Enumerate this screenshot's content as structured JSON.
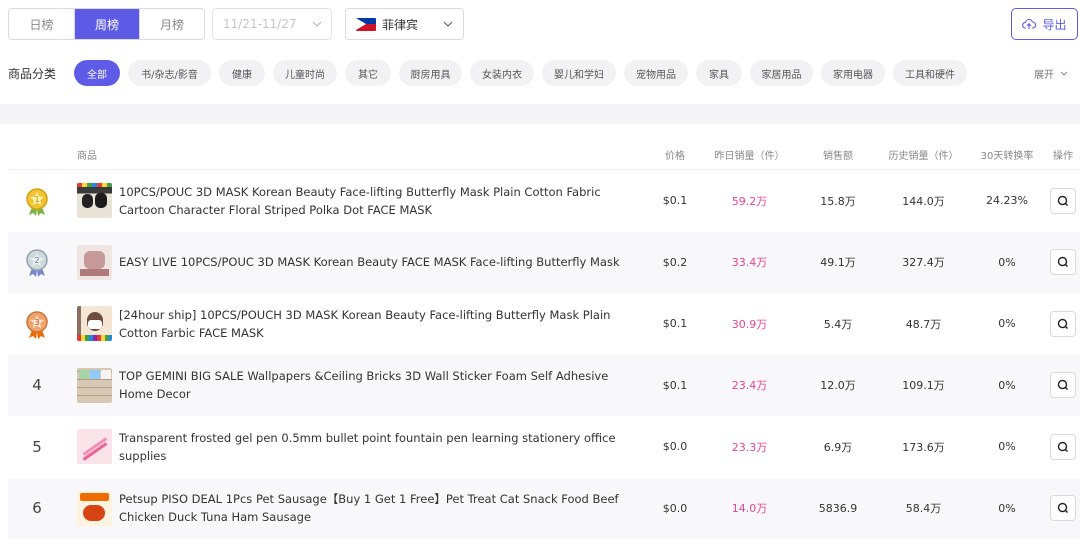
{
  "period_tabs": [
    "日榜",
    "周榜",
    "月榜"
  ],
  "active_period": 1,
  "date_range": {
    "value": "11/21-11/27"
  },
  "country": {
    "label": "菲律宾"
  },
  "export_label": "导出",
  "categories": {
    "label": "商品分类",
    "items": [
      "全部",
      "书/杂志/影音",
      "健康",
      "儿童时尚",
      "其它",
      "厨房用具",
      "女装内衣",
      "婴儿和学妇",
      "宠物用品",
      "家具",
      "家居用品",
      "家用电器",
      "工具和硬件"
    ],
    "active_index": 0,
    "expand_label": "展开"
  },
  "table": {
    "headers": {
      "product": "商品",
      "price": "价格",
      "yesterday_sales": "昨日销量（件）",
      "revenue": "销售额",
      "history_sales": "历史销量（件）",
      "conversion": "30天转换率",
      "action": "操作"
    },
    "rows": [
      {
        "rank": "1",
        "medal": "gold",
        "name": "10PCS/POUC 3D MASK Korean Beauty Face-lifting Butterfly Mask Plain Cotton Fabric Cartoon Character Floral Striped Polka Dot FACE MASK",
        "price": "$0.1",
        "yesterday_sales": "59.2万",
        "revenue": "15.8万",
        "history_sales": "144.0万",
        "conversion": "24.23%"
      },
      {
        "rank": "2",
        "medal": "silver",
        "name": "EASY LIVE 10PCS/POUC 3D MASK Korean Beauty FACE MASK Face-lifting Butterfly Mask",
        "price": "$0.2",
        "yesterday_sales": "33.4万",
        "revenue": "49.1万",
        "history_sales": "327.4万",
        "conversion": "0%"
      },
      {
        "rank": "3",
        "medal": "bronze",
        "name": "[24hour ship] 10PCS/POUCH 3D MASK Korean Beauty Face-lifting Butterfly Mask Plain Cotton Farbic FACE MASK",
        "price": "$0.1",
        "yesterday_sales": "30.9万",
        "revenue": "5.4万",
        "history_sales": "48.7万",
        "conversion": "0%"
      },
      {
        "rank": "4",
        "name": "TOP GEMINI BIG SALE Wallpapers &Ceiling Bricks 3D Wall Sticker Foam Self Adhesive Home Decor",
        "price": "$0.1",
        "yesterday_sales": "23.4万",
        "revenue": "12.0万",
        "history_sales": "109.1万",
        "conversion": "0%"
      },
      {
        "rank": "5",
        "name": "Transparent frosted gel pen 0.5mm bullet point fountain pen learning stationery office supplies",
        "price": "$0.0",
        "yesterday_sales": "23.3万",
        "revenue": "6.9万",
        "history_sales": "173.6万",
        "conversion": "0%"
      },
      {
        "rank": "6",
        "name": "Petsup PISO DEAL 1Pcs Pet Sausage【Buy 1 Get 1 Free】Pet Treat Cat Snack Food Beef Chicken Duck Tuna Ham Sausage",
        "price": "$0.0",
        "yesterday_sales": "14.0万",
        "revenue": "5836.9",
        "history_sales": "58.4万",
        "conversion": "0%"
      }
    ]
  },
  "colors": {
    "accent": "#5e5ce6",
    "highlight": "#e84393"
  }
}
